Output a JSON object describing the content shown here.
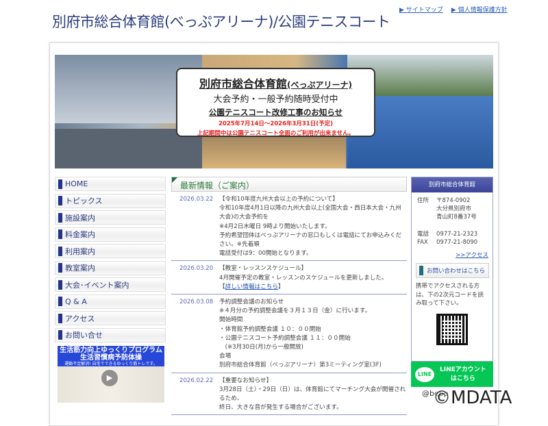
{
  "header": {
    "title": "別府市総合体育館(べっぷアリーナ)/公園テニスコート",
    "links": [
      "▶ サイトマップ",
      "▶ 個人情報保護方針"
    ]
  },
  "banner": {
    "line1": "別府市総合体育館",
    "line1_sub": "(べっぷアリーナ)",
    "line2": "大会予約・一般予約随時受付中",
    "line3": "公園テニスコート改修工事のお知らせ",
    "line4": "2025年7月14日～2026年3月31日(予定)",
    "line5": "上記期間中は公園テニスコート全面のご利用が出来ません。"
  },
  "nav": [
    "HOME",
    "トピックス",
    "施設案内",
    "料金案内",
    "利用案内",
    "教室案内",
    "大会･イベント案内",
    "Q & A",
    "アクセス",
    "お問い合せ"
  ],
  "promo": {
    "title1": "生活筋力向上ゆっくりプログラム",
    "title2": "生活習慣病予防体操",
    "caption": "運動不足解消! 自宅でできるゆっくり筋トレです。",
    "play": "▶"
  },
  "news": {
    "heading": "最新情報（ご案内）",
    "entries": [
      {
        "date": "2026.03.22",
        "lines": [
          "【令和10年度九州大会以上の予約について】",
          "令和10年度4月1日以降の九州大会以上(全国大会・西日本大会・九州大会)の大会予約を",
          "※4月2日木曜日 9時より開始いたします。",
          "予約希望団体はべっぷアリーナの窓口もしくは電話にてお申込みください。※先着順",
          "電話受付は9：00開始となります。"
        ]
      },
      {
        "date": "2026.03.20",
        "lines": [
          "【教室・レッスンスケジュール】",
          "4月開催予定の教室・レッスンのスケジュールを更新しました。"
        ],
        "link": "詳しい情報はこちら"
      },
      {
        "date": "2026.03.08",
        "lines": [
          "予約調整会議のお知らせ",
          "※４月分の予約調整会議を３月１３日（金）に行います。",
          "開始時間",
          "・体育館予約調整会議 １０：００開始",
          "・公園テニスコート予約調整会議 １１：００開始",
          "　(※3月30日(月)から一般開放)",
          "会場",
          "別府市総合体育館（べっぷアリーナ）第3ミーティング室(3F)"
        ]
      },
      {
        "date": "2026.02.22",
        "lines": [
          "【重要なお知らせ】",
          "3月28日（土）・29日（日）は、体育館にてマーチング大会が開催されるため、",
          "終日、大きな音が発生する場合がございます。"
        ]
      }
    ]
  },
  "sidebar": {
    "heading": "別府市総合体育館",
    "address_label": "住所",
    "address": [
      "〒874-0902",
      "大分県別府市",
      "青山町8番37号"
    ],
    "tel_label": "電話",
    "tel": "0977-21-2323",
    "fax_label": "FAX",
    "fax": "0977-21-8090",
    "access": ">>アクセス",
    "contact": "お問い合わせはこちら",
    "mobile": "携帯でアクセスされる方は、下の2次元コードを読み取って下さい。",
    "line_logo": "LINE",
    "line1": "LINEアカウント",
    "line2": "はこちら",
    "handle": "@bepp"
  },
  "watermark": "©MDATA"
}
